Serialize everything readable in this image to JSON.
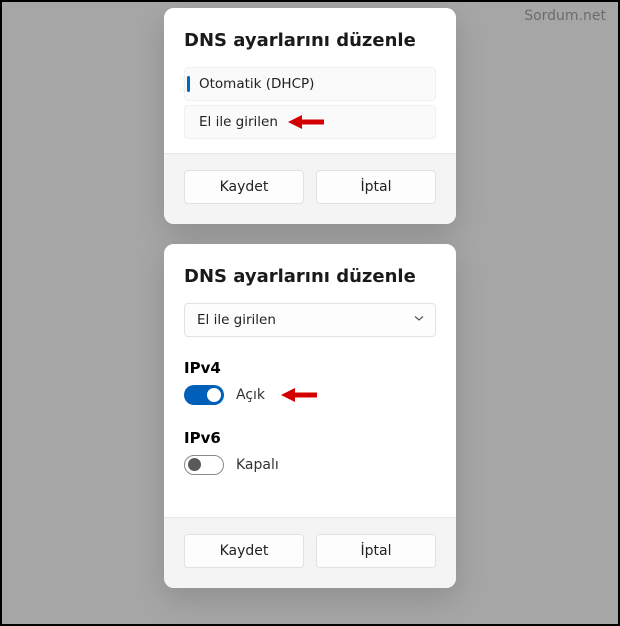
{
  "watermark": "Sordum.net",
  "dialog1": {
    "title": "DNS ayarlarını düzenle",
    "options": {
      "auto": "Otomatik (DHCP)",
      "manual": "El ile girilen"
    },
    "selected": "auto",
    "save": "Kaydet",
    "cancel": "İptal"
  },
  "dialog2": {
    "title": "DNS ayarlarını düzenle",
    "select_value": "El ile girilen",
    "ipv4": {
      "label": "IPv4",
      "state_label": "Açık",
      "on": true
    },
    "ipv6": {
      "label": "IPv6",
      "state_label": "Kapalı",
      "on": false
    },
    "save": "Kaydet",
    "cancel": "İptal"
  },
  "annotations": {
    "arrow1_target": "manual-option",
    "arrow2_target": "ipv4-toggle"
  }
}
